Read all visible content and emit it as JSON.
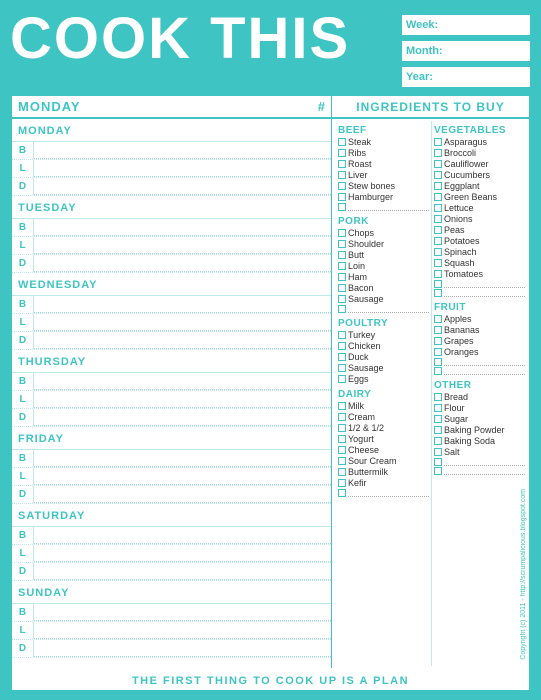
{
  "title": "COOK THIS",
  "header_fields": [
    {
      "label": "Week:",
      "value": ""
    },
    {
      "label": "Month:",
      "value": ""
    },
    {
      "label": "Year:",
      "value": ""
    }
  ],
  "top_header": {
    "day_col": "MONDAY",
    "hash": "#",
    "ingredients": "INGREDIENTS TO BUY"
  },
  "days": [
    {
      "name": "MONDAY",
      "meals": [
        "B",
        "L",
        "D"
      ]
    },
    {
      "name": "TUESDAY",
      "meals": [
        "B",
        "L",
        "D"
      ]
    },
    {
      "name": "WEDNESDAY",
      "meals": [
        "B",
        "L",
        "D"
      ]
    },
    {
      "name": "THURSDAY",
      "meals": [
        "B",
        "L",
        "D"
      ]
    },
    {
      "name": "FRIDAY",
      "meals": [
        "B",
        "L",
        "D"
      ]
    },
    {
      "name": "SATURDAY",
      "meals": [
        "B",
        "L",
        "D"
      ]
    },
    {
      "name": "SUNDAY",
      "meals": [
        "B",
        "L",
        "D"
      ]
    }
  ],
  "ingredients": {
    "left_col": {
      "beef": {
        "cat": "BEEF",
        "items": [
          "Steak",
          "Ribs",
          "Roast",
          "Liver",
          "Stew bones",
          "Hamburger"
        ],
        "blanks": 1
      },
      "pork": {
        "cat": "PORK",
        "items": [
          "Chops",
          "Shoulder",
          "Butt",
          "Loin",
          "Ham",
          "Bacon",
          "Sausage"
        ],
        "blanks": 1
      },
      "poultry": {
        "cat": "POULTRY",
        "items": [
          "Turkey",
          "Chicken",
          "Duck",
          "Sausage",
          "Eggs"
        ],
        "blanks": 0
      },
      "dairy": {
        "cat": "DAIRY",
        "items": [
          "Milk",
          "Cream",
          "1/2 & 1/2",
          "Yogurt",
          "Cheese",
          "Sour Cream",
          "Buttermilk",
          "Kefir"
        ],
        "blanks": 1
      }
    },
    "right_col": {
      "vegetables": {
        "cat": "VEGETABLES",
        "items": [
          "Asparagus",
          "Broccoli",
          "Cauliflower",
          "Cucumbers",
          "Eggplant",
          "Green Beans",
          "Lettuce",
          "Onions",
          "Peas",
          "Potatoes",
          "Spinach",
          "Squash",
          "Tomatoes"
        ],
        "blanks": 2
      },
      "fruit": {
        "cat": "FRUIT",
        "items": [
          "Apples",
          "Bananas",
          "Grapes",
          "Oranges"
        ],
        "blanks": 2
      },
      "other": {
        "cat": "OTHER",
        "items": [
          "Bread",
          "Flour",
          "Sugar",
          "Baking Powder",
          "Baking Soda",
          "Salt"
        ],
        "blanks": 2
      }
    }
  },
  "footer": "THE FIRST THING TO COOK UP IS A PLAN",
  "copyright": "Copyright (c) 2011 - http://scrumpalicious.blogspot.com"
}
